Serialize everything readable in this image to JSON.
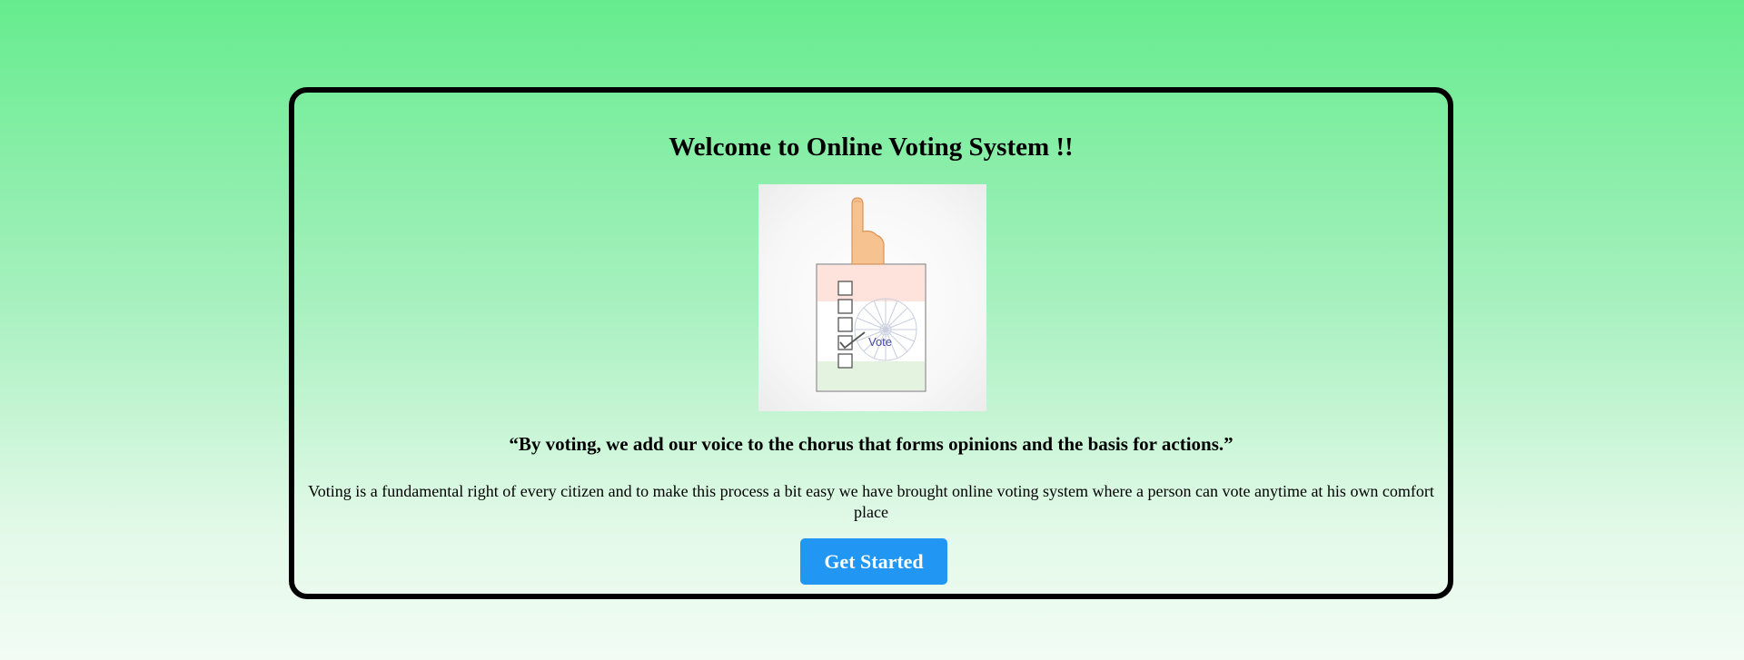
{
  "hero": {
    "title": "Welcome to Online Voting System !!",
    "illustration": {
      "icon": "vote-ballot-icon",
      "label": "Vote"
    },
    "quote": "“By voting, we add our voice to the chorus that forms opinions and the basis for actions.”",
    "description": "Voting is a fundamental right of every citizen and to make this process a bit easy we have brought online voting system where a person can vote anytime at his own comfort place",
    "cta_label": "Get Started"
  },
  "colors": {
    "background_top": "#66ec8e",
    "background_bottom": "#f2fcf4",
    "button": "#2196f3",
    "border": "#000000"
  }
}
